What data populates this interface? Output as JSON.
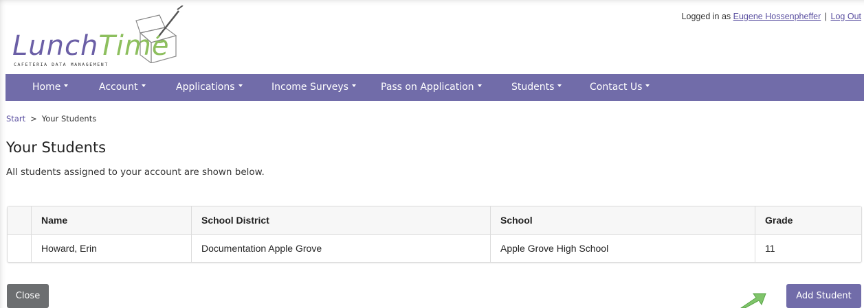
{
  "brand": {
    "word_part1": "Lunch",
    "word_part2": "Time",
    "tagline": "CAFETERIA DATA MANAGEMENT",
    "colors": {
      "purple": "#6b5fa6",
      "green": "#8dbf5e"
    }
  },
  "userbar": {
    "prefix": "Logged in as",
    "user_name": "Eugene Hossenpheffer",
    "separator": "|",
    "logout_label": "Log Out"
  },
  "nav": {
    "background": "#716ca9",
    "items": [
      {
        "label": "Home"
      },
      {
        "label": "Account"
      },
      {
        "label": "Applications"
      },
      {
        "label": "Income Surveys"
      },
      {
        "label": "Pass on Application"
      },
      {
        "label": "Students"
      },
      {
        "label": "Contact Us"
      }
    ]
  },
  "breadcrumb": {
    "start_label": "Start",
    "separator": ">",
    "current": "Your Students"
  },
  "page": {
    "title": "Your Students",
    "description": "All students assigned to your account are shown below."
  },
  "table": {
    "columns": [
      "",
      "Name",
      "School District",
      "School",
      "Grade"
    ],
    "rows": [
      [
        "",
        "Howard, Erin",
        "Documentation Apple Grove",
        "Apple Grove High School",
        "11"
      ]
    ]
  },
  "buttons": {
    "close_label": "Close",
    "add_student_label": "Add Student",
    "close_color": "#6c6e70",
    "add_color": "#716ca9"
  },
  "icons": {
    "logo_box": "lunchbox-pencil-icon",
    "nav_caret": "caret-down-icon",
    "hint_arrow": "pointer-arrow-icon"
  }
}
